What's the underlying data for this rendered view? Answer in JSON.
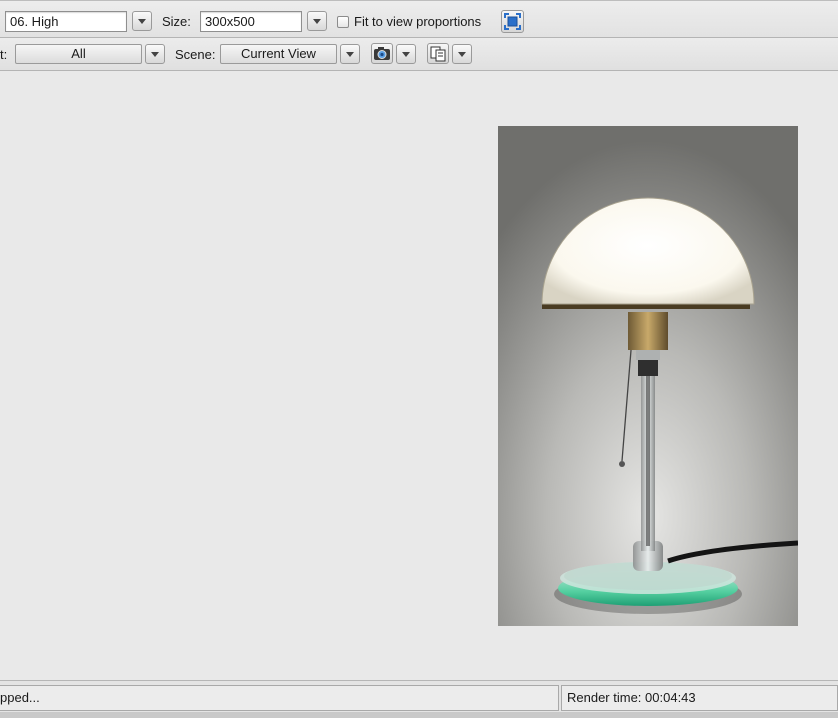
{
  "toolbar": {
    "quality_value": "06. High",
    "size_label": "Size:",
    "size_value": "300x500",
    "fit_label": "Fit to view proportions",
    "fit_checked": false,
    "region_label_partial": "t:",
    "region_value": "All",
    "scene_label": "Scene:",
    "scene_value": "Current View",
    "icons": [
      "camera-icon",
      "copy-windows-icon",
      "fit-frame-icon",
      "chevron-down-icon"
    ]
  },
  "render": {
    "width": 300,
    "height": 500
  },
  "status": {
    "message": "pped...",
    "render_time": "Render time: 00:04:43"
  },
  "colors": {
    "accent_blue": "#2a6fc9",
    "glass_teal": "#2fbf8a"
  }
}
